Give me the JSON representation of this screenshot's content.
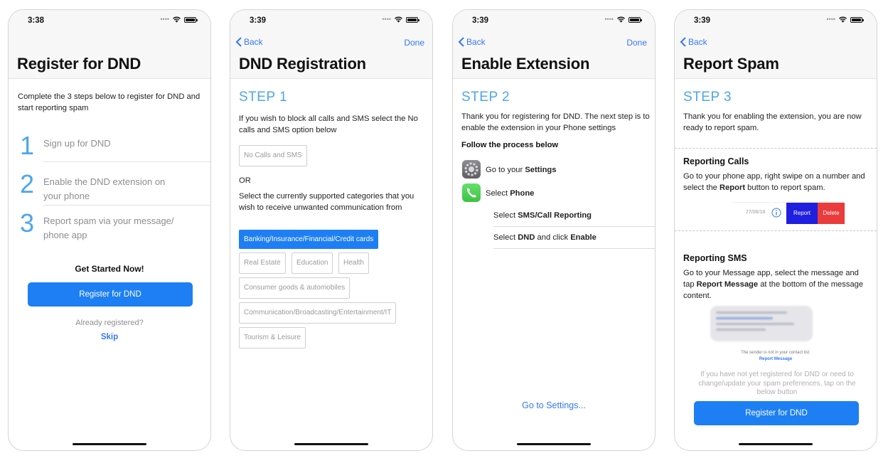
{
  "screens": [
    {
      "status_time": "3:38",
      "title": "Register for DND",
      "intro": "Complete the 3 steps below to register for DND and start reporting spam",
      "steps": [
        {
          "number": "1",
          "text": "Sign up for DND"
        },
        {
          "number": "2",
          "text": "Enable the DND extension on your phone"
        },
        {
          "number": "3",
          "text": "Report spam via your message/ phone app"
        }
      ],
      "get_started": "Get Started Now!",
      "register_button": "Register for DND",
      "already_registered": "Already registered?",
      "skip": "Skip"
    },
    {
      "status_time": "3:39",
      "back": "Back",
      "done": "Done",
      "title": "DND Registration",
      "step_heading": "STEP 1",
      "block_text": "If you wish to block all calls and SMS select the No calls and SMS option below",
      "no_calls_option": "No Calls and SMS",
      "or": "OR",
      "category_text": "Select the currently supported categories that you wish to receive unwanted communication from",
      "categories": [
        "Banking/Insurance/Financial/Credit cards",
        "Real Estate",
        "Education",
        "Health",
        "Consumer goods & automobiles",
        "Communication/Broadcasting/Entertainment/IT",
        "Tourism & Leisure"
      ],
      "selected_category": "Banking/Insurance/Financial/Credit cards"
    },
    {
      "status_time": "3:39",
      "back": "Back",
      "done": "Done",
      "title": "Enable Extension",
      "step_heading": "STEP 2",
      "body": "Thank you for registering for DND. The next step is to enable the extension in your Phone settings",
      "follow": "Follow the process below",
      "row_settings_prefix": "Go to your ",
      "row_settings_bold": "Settings",
      "row_phone_prefix": "Select ",
      "row_phone_bold": "Phone",
      "row_sms_prefix": "Select ",
      "row_sms_bold": "SMS/Call Reporting",
      "row_dnd_prefix": "Select ",
      "row_dnd_bold": "DND",
      "row_dnd_mid": " and click ",
      "row_dnd_bold2": "Enable",
      "go_settings": "Go to Settings..."
    },
    {
      "status_time": "3:39",
      "back": "Back",
      "title": "Report Spam",
      "step_heading": "STEP 3",
      "body": "Thank you for enabling the extension, you are now ready to report spam.",
      "calls_heading": "Reporting Calls",
      "calls_text_1": "Go to your phone app, right swipe on a  number and select the ",
      "calls_text_bold": "Report",
      "calls_text_2": " button to report spam.",
      "call_date": "27/08/18",
      "report_btn": "Report",
      "delete_btn": "Delete",
      "sms_heading": "Reporting SMS",
      "sms_text_1": "Go to  your Message app,  select the message and tap ",
      "sms_text_bold": "Report Message",
      "sms_text_2": "  at the bottom of the message content.",
      "sender_note": "The sender is not in your contact list.",
      "report_message_link": "Report Message",
      "footer_note": "If you have not yet registered for DND or need to change/update your spam preferences, tap on the below button",
      "register_button": "Register for DND"
    }
  ],
  "colors": {
    "accent": "#1d7ff3",
    "step_blue": "#4da6ec",
    "link": "#3478f6",
    "report_red": "#ea3c3c",
    "report_blue": "#1f1fe0"
  }
}
